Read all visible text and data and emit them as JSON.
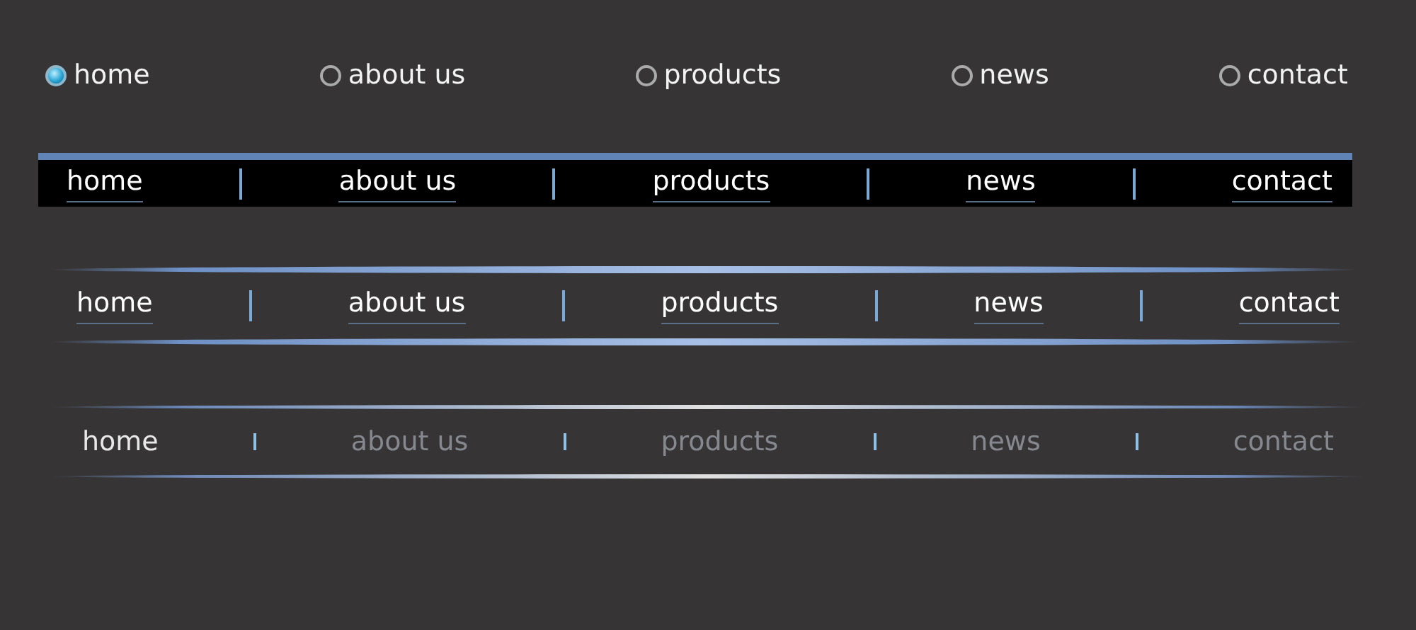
{
  "navigation_bars": [
    {
      "kind": "radio",
      "items": [
        {
          "label": "home",
          "selected": true
        },
        {
          "label": "about us",
          "selected": false
        },
        {
          "label": "products",
          "selected": false
        },
        {
          "label": "news",
          "selected": false
        },
        {
          "label": "contact",
          "selected": false
        }
      ]
    },
    {
      "kind": "black-bar",
      "items": [
        {
          "label": "home"
        },
        {
          "label": "about us"
        },
        {
          "label": "products"
        },
        {
          "label": "news"
        },
        {
          "label": "contact"
        }
      ]
    },
    {
      "kind": "glow-bar",
      "items": [
        {
          "label": "home"
        },
        {
          "label": "about us"
        },
        {
          "label": "products"
        },
        {
          "label": "news"
        },
        {
          "label": "contact"
        }
      ]
    },
    {
      "kind": "line-bar",
      "items": [
        {
          "label": "home",
          "selected": true
        },
        {
          "label": "about us",
          "selected": false
        },
        {
          "label": "products",
          "selected": false
        },
        {
          "label": "news",
          "selected": false
        },
        {
          "label": "contact",
          "selected": false
        }
      ]
    }
  ]
}
